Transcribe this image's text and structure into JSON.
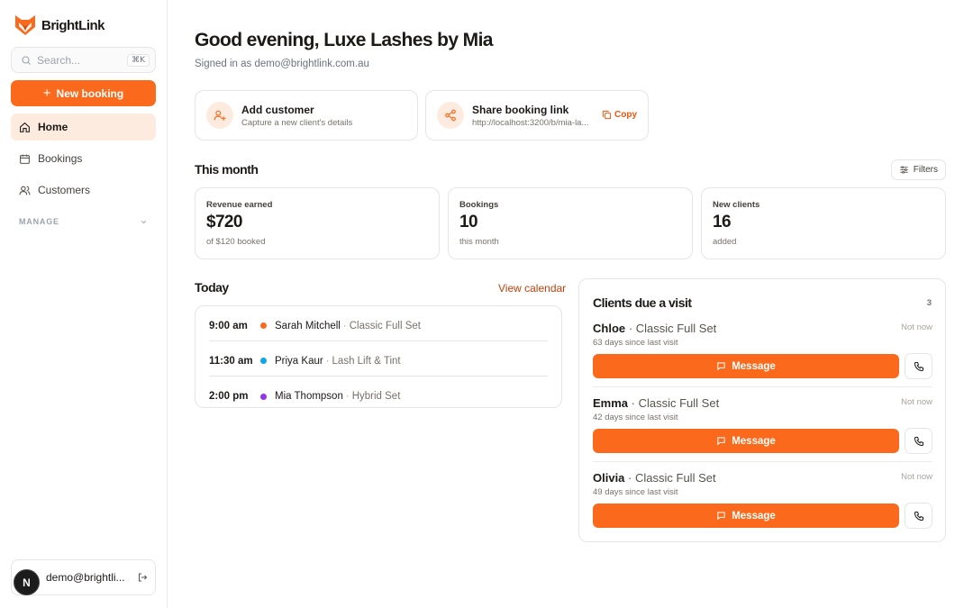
{
  "app": {
    "name": "BrightLink"
  },
  "colors": {
    "accent": "#fb6a1c",
    "accent_soft": "#fdebe0",
    "dot_orange": "#fb6a1c",
    "dot_blue": "#0ea5e9",
    "dot_purple": "#9333ea"
  },
  "sidebar": {
    "search_placeholder": "Search...",
    "search_shortcut": "⌘K",
    "new_booking_label": "New booking",
    "items": [
      {
        "label": "Home",
        "icon": "home-icon",
        "active": true
      },
      {
        "label": "Bookings",
        "icon": "calendar-icon"
      },
      {
        "label": "Customers",
        "icon": "users-icon"
      }
    ],
    "section_label": "MANAGE",
    "user": {
      "avatar_letter": "N",
      "email": "demo@brightli..."
    }
  },
  "header": {
    "greeting": "Good evening, Luxe Lashes by Mia",
    "signed_in": "Signed in as demo@brightlink.com.au"
  },
  "actions": [
    {
      "title": "Add customer",
      "subtitle": "Capture a new client's details",
      "icon": "user-plus-icon"
    },
    {
      "title": "Share booking link",
      "subtitle": "http://localhost:3200/b/mia-la...",
      "icon": "share-icon",
      "copy_label": "Copy"
    }
  ],
  "this_month": {
    "title": "This month",
    "filters_label": "Filters",
    "stats": [
      {
        "label": "Revenue earned",
        "value": "$720",
        "sub": "of $120 booked"
      },
      {
        "label": "Bookings",
        "value": "10",
        "sub": "this month"
      },
      {
        "label": "New clients",
        "value": "16",
        "sub": "added"
      }
    ]
  },
  "today": {
    "title": "Today",
    "view_calendar": "View calendar",
    "appointments": [
      {
        "time": "9:00 am",
        "name": "Sarah Mitchell",
        "service": "Classic Full Set",
        "dot": "#fb6a1c"
      },
      {
        "time": "11:30 am",
        "name": "Priya Kaur",
        "service": "Lash Lift & Tint",
        "dot": "#0ea5e9"
      },
      {
        "time": "2:00 pm",
        "name": "Mia Thompson",
        "service": "Hybrid Set",
        "dot": "#9333ea"
      }
    ]
  },
  "due": {
    "title": "Clients due a visit",
    "count": "3",
    "message_label": "Message",
    "not_now_label": "Not now",
    "clients": [
      {
        "name": "Chloe",
        "service": "Classic Full Set",
        "days": "63 days since last visit"
      },
      {
        "name": "Emma",
        "service": "Classic Full Set",
        "days": "42 days since last visit"
      },
      {
        "name": "Olivia",
        "service": "Classic Full Set",
        "days": "49 days since last visit"
      }
    ]
  }
}
